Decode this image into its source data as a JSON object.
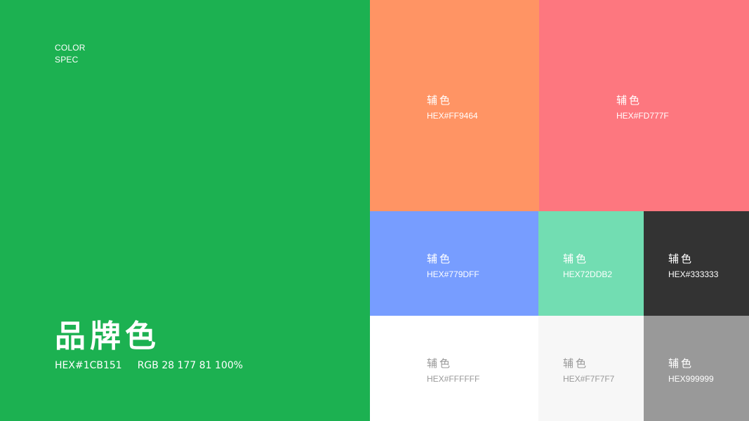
{
  "spec": {
    "line1": "COLOR",
    "line2": "SPEC"
  },
  "primary": {
    "title": "品牌色",
    "hex": "HEX#1CB151",
    "rgb": "RGB 28 177 81 100%",
    "color": "#1CB151"
  },
  "swatches": [
    {
      "name": "辅色",
      "hex": "HEX#FF9464",
      "color": "#FF9464"
    },
    {
      "name": "辅色",
      "hex": "HEX#FD777F",
      "color": "#FD777F"
    },
    {
      "name": "辅色",
      "hex": "HEX#779DFF",
      "color": "#779DFF"
    },
    {
      "name": "辅色",
      "hex": "HEX72DDB2",
      "color": "#72DDB2"
    },
    {
      "name": "辅色",
      "hex": "HEX#333333",
      "color": "#333333"
    },
    {
      "name": "辅色",
      "hex": "HEX#FFFFFF",
      "color": "#FFFFFF"
    },
    {
      "name": "辅色",
      "hex": "HEX#F7F7F7",
      "color": "#F7F7F7"
    },
    {
      "name": "辅色",
      "hex": "HEX999999",
      "color": "#999999"
    }
  ]
}
